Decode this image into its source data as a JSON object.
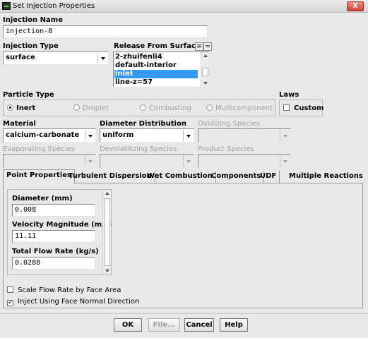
{
  "window": {
    "title": "Set Injection Properties",
    "close_glyph": "X"
  },
  "injection_name": {
    "label": "Injection Name",
    "value": "injection-8"
  },
  "injection_type": {
    "label": "Injection Type",
    "value": "surface"
  },
  "release_from_surfaces": {
    "label": "Release From Surfaces",
    "btn1": "≡",
    "btn2": "=",
    "items": [
      "2-zhuifenli4",
      "default-interior",
      "inlet",
      "line-z=57"
    ],
    "selected": "inlet"
  },
  "particle_type": {
    "label": "Particle Type",
    "options": [
      "Inert",
      "Droplet",
      "Combusting",
      "Multicomponent"
    ],
    "selected": "Inert"
  },
  "laws": {
    "label": "Laws",
    "custom_label": "Custom",
    "custom_checked": false
  },
  "material": {
    "label": "Material",
    "value": "calcium-carbonate"
  },
  "diameter_distribution": {
    "label": "Diameter Distribution",
    "value": "uniform"
  },
  "oxidizing_species": {
    "label": "Oxidizing Species",
    "value": ""
  },
  "evaporating_species": {
    "label": "Evaporating Species",
    "value": ""
  },
  "devolatilizing_species": {
    "label": "Devolatilizing Species",
    "value": ""
  },
  "product_species": {
    "label": "Product Species",
    "value": ""
  },
  "tabs": [
    "Point Properties",
    "Turbulent Dispersion",
    "Wet Combustion",
    "Components",
    "UDF",
    "Multiple Reactions"
  ],
  "active_tab": "Point Properties",
  "point_properties": {
    "diameter": {
      "label": "Diameter (mm)",
      "value": "0.008"
    },
    "velocity": {
      "label": "Velocity Magnitude (m/s)",
      "value": "11.11"
    },
    "flow_rate": {
      "label": "Total Flow Rate (kg/s)",
      "value": "0.0288"
    }
  },
  "options": {
    "scale_flow_rate": {
      "label": "Scale Flow Rate by Face Area",
      "checked": false
    },
    "inject_normal": {
      "label": "Inject Using Face Normal Direction",
      "checked": true,
      "mark": "✓"
    }
  },
  "buttons": {
    "ok": "OK",
    "file": "File...",
    "cancel": "Cancel",
    "help": "Help"
  }
}
